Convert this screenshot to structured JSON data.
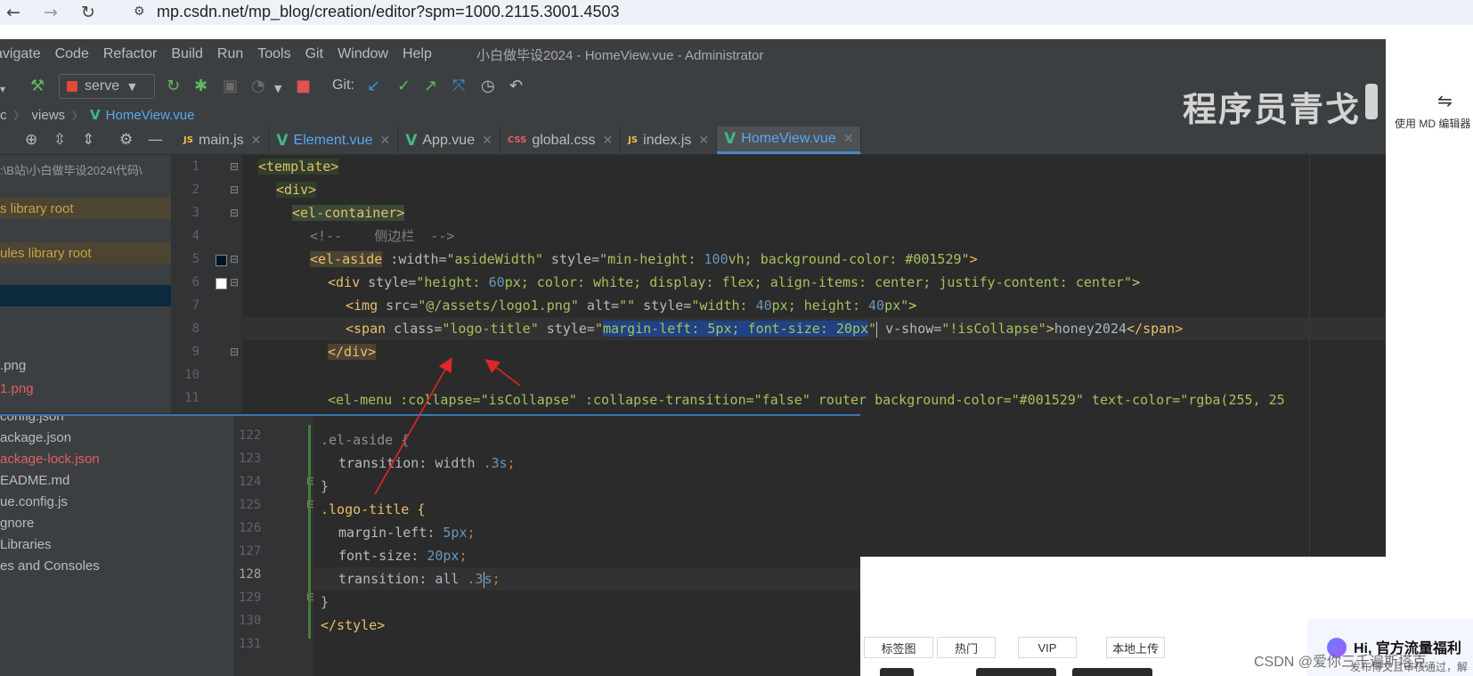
{
  "browser": {
    "back_icon": "arrow-left-icon",
    "forward_icon": "arrow-right-icon",
    "reload_icon": "reload-icon",
    "url": "mp.csdn.net/mp_blog/creation/editor?spm=1000.2115.3001.4503"
  },
  "ide": {
    "menu": [
      "avigate",
      "Code",
      "Refactor",
      "Build",
      "Run",
      "Tools",
      "Git",
      "Window",
      "Help"
    ],
    "title": "小白做毕设2024 - HomeView.vue - Administrator",
    "run_config": "serve",
    "git_label": "Git:",
    "breadcrumb": [
      "c",
      "views",
      "HomeView.vue"
    ],
    "tabs": [
      {
        "icon": "JS",
        "label": "main.js",
        "active": false
      },
      {
        "icon": "V",
        "label": "Element.vue",
        "active": false
      },
      {
        "icon": "V",
        "label": "App.vue",
        "active": false
      },
      {
        "icon": "CSS",
        "label": "global.css",
        "active": false
      },
      {
        "icon": "JS",
        "label": "index.js",
        "active": false
      },
      {
        "icon": "V",
        "label": "HomeView.vue",
        "active": true
      }
    ],
    "tree_top": [
      ":\\B站\\小白做毕设2024\\代码\\",
      "s  library root",
      "ules  library root",
      "",
      "",
      ".png",
      "1.png"
    ],
    "line_numbers": [
      "1",
      "2",
      "3",
      "4",
      "5",
      "6",
      "7",
      "8",
      "9",
      "10",
      "11"
    ],
    "code": {
      "l1": "<template>",
      "l2": "<div>",
      "l3": "<el-container>",
      "l4": "<!--    侧边栏  -->",
      "l5_tag": "<el-aside",
      "l5_a1": " :width=",
      "l5_v1": "\"asideWidth\"",
      "l5_a2": " style=",
      "l5_q1": "\"min-height: ",
      "l5_n1": "100",
      "l5_q2": "vh; background-color: #001529\"",
      "l5_end": ">",
      "l6_tag": "<div",
      "l6_a": " style=",
      "l6_q1": "\"height: ",
      "l6_n1": "60",
      "l6_q2": "px; color: white; display: flex; align-items: center; justify-content: center\"",
      "l6_end": ">",
      "l7_tag": "<img",
      "l7_a1": " src=",
      "l7_v1": "\"@/assets/logo1.png\"",
      "l7_a2": " alt=",
      "l7_v2": "\"\"",
      "l7_a3": " style=",
      "l7_q1": "\"width: ",
      "l7_n1": "40",
      "l7_q2": "px; height: ",
      "l7_n2": "40",
      "l7_q3": "px\"",
      "l7_end": ">",
      "l8_tag": "<span",
      "l8_a1": " class=",
      "l8_v1": "\"logo-title\"",
      "l8_a2": " style=",
      "l8_q0": "\"",
      "l8_sel": "margin-left: 5px; font-size: 20px",
      "l8_q3": "\"",
      "l8_a3": " v-show=",
      "l8_v3": "\"!isCollapse\"",
      "l8_end": ">",
      "l8_txt": "honey2024",
      "l8_close": "</span>",
      "l9": "</div>",
      "l11": "<el-menu :collapse=\"isCollapse\" :collapse-transition=\"false\" router background-color=\"#001529\" text-color=\"rgba(255, 25"
    }
  },
  "overlay": {
    "tree": [
      "config.json",
      "ackage.json",
      "ackage-lock.json",
      "EADME.md",
      "ue.config.js",
      "gnore",
      "Libraries",
      "es and Consoles"
    ],
    "line_numbers": [
      "122",
      "123",
      "124",
      "125",
      "126",
      "127",
      "128",
      "129",
      "130",
      "131"
    ],
    "css": {
      "c122": ".el-aside {",
      "c123_p": "transition",
      "c123_v": ": width ",
      "c123_n": ".3s",
      "c123_e": ";",
      "c124": "}",
      "c125": ".logo-title {",
      "c126_p": "margin-left",
      "c126_v": ": ",
      "c126_n": "5px",
      "c126_e": ";",
      "c127_p": "font-size",
      "c127_v": ": ",
      "c127_n": "20px",
      "c127_e": ";",
      "c128_p": "transition",
      "c128_v": ": all ",
      "c128_n1": ".3",
      "c128_n2": "s",
      "c128_e": ";",
      "c129": "}",
      "c130": "</style>"
    }
  },
  "page": {
    "md_switch_label": "使用 MD 编辑器",
    "buttons": [
      "标签图",
      "热门",
      "VIP",
      "本地上传"
    ],
    "promo_title": "Hi, 官方流量福利",
    "promo_sub": "发布博文且审核通过，解",
    "brand_watermark": "程序员青戈",
    "csdn_watermark": "CSDN @爱你三千遍斯塔克"
  },
  "colors": {
    "annotation_arrow": "#e0262a",
    "ide_bg": "#2b2b2b",
    "selection": "#214283",
    "vue_green": "#41b883",
    "active_tab": "#56a8f5"
  }
}
